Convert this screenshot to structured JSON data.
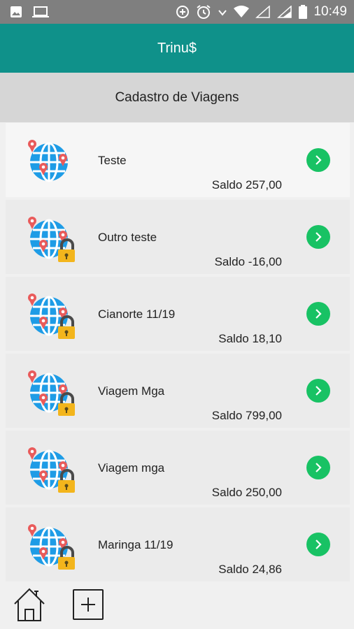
{
  "status_bar": {
    "time": "10:49",
    "icons": [
      "image-icon",
      "laptop-icon",
      "data-saver-icon",
      "alarm-icon",
      "vibrate-icon",
      "wifi-icon",
      "signal-icon",
      "signal-icon",
      "battery-icon"
    ]
  },
  "app": {
    "title": "Trinu$",
    "accent": "#0f918a"
  },
  "header": {
    "title": "Cadastro de Viagens"
  },
  "trips": [
    {
      "name": "Teste",
      "saldo": "Saldo 257,00",
      "locked": false
    },
    {
      "name": "Outro teste",
      "saldo": "Saldo -16,00",
      "locked": true
    },
    {
      "name": "Cianorte 11/19",
      "saldo": "Saldo 18,10",
      "locked": true
    },
    {
      "name": "Viagem Mga",
      "saldo": "Saldo 799,00",
      "locked": true
    },
    {
      "name": "Viagem mga",
      "saldo": "Saldo 250,00",
      "locked": true
    },
    {
      "name": "Maringa 11/19",
      "saldo": "Saldo 24,86",
      "locked": true
    }
  ],
  "bottom_nav": {
    "items": [
      "home-icon",
      "plus-icon"
    ]
  }
}
